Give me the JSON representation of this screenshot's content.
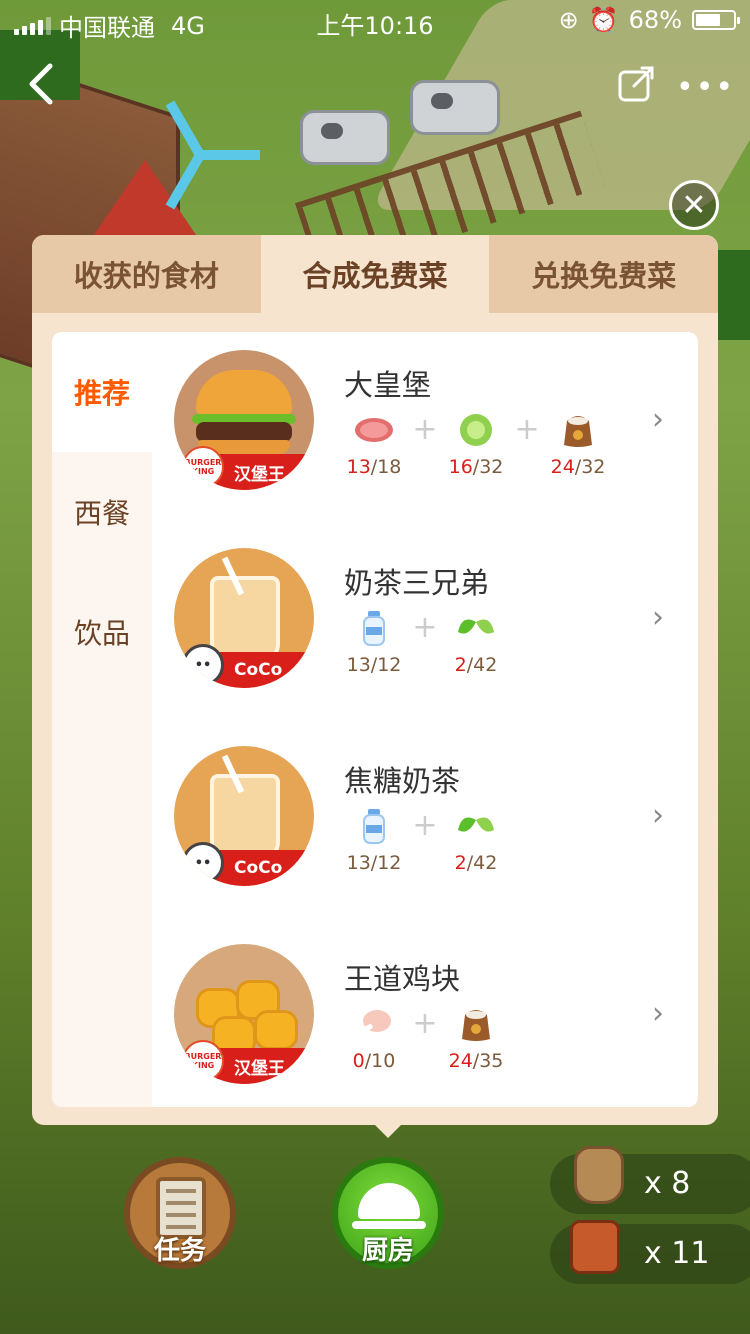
{
  "status_bar": {
    "carrier": "中国联通",
    "network": "4G",
    "time": "上午10:16",
    "battery": "68%",
    "battery_level": 0.68
  },
  "nav": {
    "back_icon": "chevron-left-icon",
    "share_icon": "share-icon",
    "more_icon": "more-icon"
  },
  "tabs": [
    {
      "label": "收获的食材",
      "active": false
    },
    {
      "label": "合成免费菜",
      "active": true
    },
    {
      "label": "兑换免费菜",
      "active": false
    }
  ],
  "categories": [
    {
      "label": "推荐",
      "active": true
    },
    {
      "label": "西餐",
      "active": false
    },
    {
      "label": "饮品",
      "active": false
    }
  ],
  "dishes": [
    {
      "name": "大皇堡",
      "brand": "汉堡王",
      "brand_logo": "BURGER KING",
      "ingredients": [
        {
          "icon": "meat-icon",
          "have": "13",
          "need": "/18"
        },
        {
          "icon": "lettuce-icon",
          "have": "16",
          "need": "/32"
        },
        {
          "icon": "flour-sack-icon",
          "have": "24",
          "need": "/32"
        }
      ]
    },
    {
      "name": "奶茶三兄弟",
      "brand": "CoCo",
      "ingredients": [
        {
          "icon": "milk-bottle-icon",
          "have": "13",
          "need": "/12"
        },
        {
          "icon": "tea-leaf-icon",
          "have": "2",
          "need": "/42"
        }
      ]
    },
    {
      "name": "焦糖奶茶",
      "brand": "CoCo",
      "ingredients": [
        {
          "icon": "milk-bottle-icon",
          "have": "13",
          "need": "/12"
        },
        {
          "icon": "tea-leaf-icon",
          "have": "2",
          "need": "/42"
        }
      ]
    },
    {
      "name": "王道鸡块",
      "brand": "汉堡王",
      "brand_logo": "BURGER KING",
      "ingredients": [
        {
          "icon": "chicken-leg-icon",
          "have": "0",
          "need": "/10"
        },
        {
          "icon": "flour-sack-icon",
          "have": "24",
          "need": "/35"
        }
      ]
    }
  ],
  "bottom": {
    "task_label": "任务",
    "kitchen_label": "厨房",
    "resources": [
      {
        "icon": "grain-sack-icon",
        "label": "x 8"
      },
      {
        "icon": "watering-can-icon",
        "label": "x 11"
      }
    ]
  },
  "colors": {
    "accent": "#ff5a00",
    "shortage": "#d91f1a",
    "panel": "#f6e4cf",
    "tab_inactive": "#e7c9a7"
  }
}
